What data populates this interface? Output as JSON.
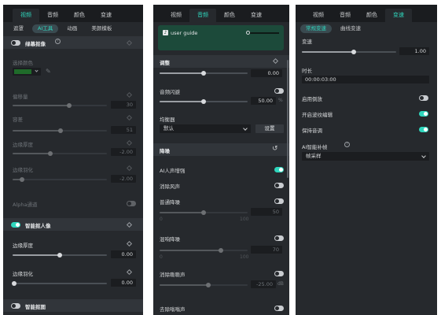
{
  "colors": {
    "accent": "#2fd6bd",
    "panel": "#26292d",
    "tabbar": "#1a1c1f",
    "green_swatch": "#1f6b2a",
    "player": "#1c4a3a"
  },
  "panel1": {
    "tabs": [
      "视频",
      "音频",
      "颜色",
      "变速"
    ],
    "subtabs": [
      "遮罩",
      "AI工具",
      "动画",
      "美颜模板"
    ],
    "chroma": {
      "title": "绿幕抠像",
      "pick_color_label": "选择颜色",
      "offset_label": "偏移量",
      "offset_value": "30",
      "tolerance_label": "容差",
      "tolerance_value": "51",
      "edge_thickness_label": "边缘厚度",
      "edge_thickness_value": "-2.00",
      "edge_feather_label": "边缘羽化",
      "edge_feather_value": "-2.00",
      "alpha_label": "Alpha通道"
    },
    "smart_cutout": {
      "title": "智能抠人像",
      "edge_thickness_label": "边缘厚度",
      "edge_thickness_value": "0.00",
      "edge_feather_label": "边缘羽化",
      "edge_feather_value": "0.00"
    },
    "smart_mask": {
      "title": "智能抠图"
    }
  },
  "panel2": {
    "tabs": [
      "视频",
      "音频",
      "颜色",
      "变速"
    ],
    "player_label": "user guide",
    "adjust": {
      "title": "调整",
      "top_value": "0.00",
      "ducking_label": "音频闪避",
      "ducking_value": "50.00",
      "ducking_unit": "%"
    },
    "eq": {
      "label": "均衡器",
      "selected": "默认",
      "settings_button": "设置"
    },
    "denoise": {
      "title": "降噪",
      "ai_voice_label": "AI人声增强",
      "wind_label": "消除风声",
      "normal_label": "普通降噪",
      "normal_value": "50",
      "normal_min": "0",
      "normal_max": "100",
      "reverb_label": "混响降噪",
      "reverb_value": "70",
      "reverb_min": "0",
      "reverb_max": "100",
      "hiss_label": "消除嘶嘶声",
      "hiss_value": "-25.00",
      "hiss_unit": "dB",
      "hum_label": "去除嗡嗡声"
    }
  },
  "panel3": {
    "tabs": [
      "视频",
      "音频",
      "颜色",
      "变速"
    ],
    "subtabs": [
      "常规变速",
      "曲线变速"
    ],
    "speed_label": "变速",
    "speed_value": "1.00",
    "duration_label": "时长",
    "duration_value": "00:00:03:00",
    "reverse_label": "启用倒放",
    "ripple_label": "开启波纹编辑",
    "pitch_label": "保持音调",
    "ai_frame_label": "AI智能补帧",
    "ai_frame_value": "帧采样"
  }
}
